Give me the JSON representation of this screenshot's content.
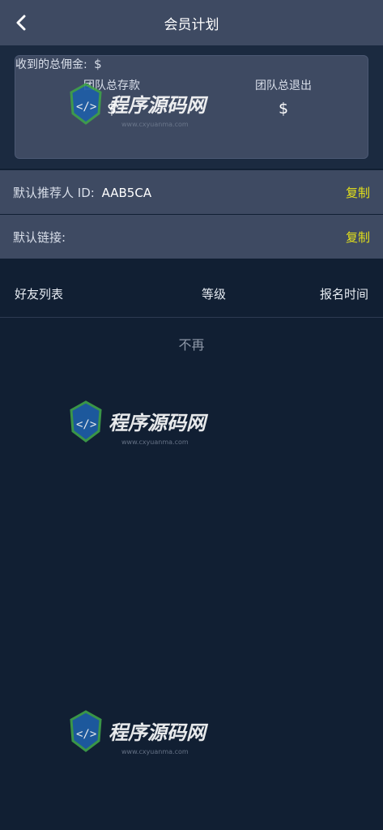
{
  "header": {
    "title": "会员计划",
    "back_icon": "chevron-left-icon"
  },
  "summary": {
    "total_deposit_label": "团队总存款",
    "total_deposit_value": "$",
    "total_withdraw_label": "团队总退出",
    "total_withdraw_value": "$",
    "commission_label": "收到的总佣金:",
    "commission_value": "$"
  },
  "referral": {
    "id_label": "默认推荐人 ID:",
    "id_value": "AAB5CA",
    "id_copy": "复制",
    "link_label": "默认链接:",
    "link_copy": "复制"
  },
  "friends": {
    "col_list": "好友列表",
    "col_level": "等级",
    "col_time": "报名时间",
    "empty_text": "不再"
  },
  "watermark": {
    "title": "程序源码网",
    "url": "www.cxyuanma.com"
  },
  "colors": {
    "accent_copy": "#e3e01a",
    "panel": "#3e4a62",
    "background": "#111f33"
  }
}
